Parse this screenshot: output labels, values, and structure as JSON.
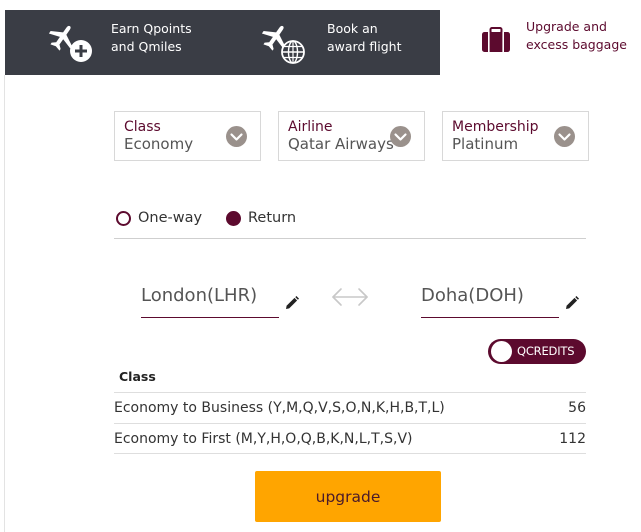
{
  "tabs": {
    "earn": {
      "label": "Earn Qpoints\nand Qmiles"
    },
    "book": {
      "label": "Book an\naward flight"
    },
    "upgrade": {
      "label": "Upgrade and\nexcess baggage"
    }
  },
  "filters": {
    "class": {
      "label": "Class",
      "value": "Economy"
    },
    "airline": {
      "label": "Airline",
      "value": "Qatar Airways"
    },
    "membership": {
      "label": "Membership",
      "value": "Platinum"
    }
  },
  "trip_type": {
    "oneway": "One-way",
    "return": "Return",
    "selected": "return"
  },
  "route": {
    "from": "London(LHR)",
    "to": "Doha(DOH)"
  },
  "qcredits_toggle": {
    "label": "QCREDITS"
  },
  "table": {
    "header": "Class",
    "rows": [
      {
        "description": "Economy to Business (Y,M,Q,V,S,O,N,K,H,B,T,L)",
        "value": "56"
      },
      {
        "description": "Economy to First (M,Y,H,O,Q,B,K,N,L,T,S,V)",
        "value": "112"
      }
    ]
  },
  "upgrade_button": {
    "label": "upgrade"
  },
  "colors": {
    "brand": "#5c0a2e",
    "tab_bar": "#3a3d45",
    "button": "#ffa500",
    "chevron": "#9a918c"
  }
}
